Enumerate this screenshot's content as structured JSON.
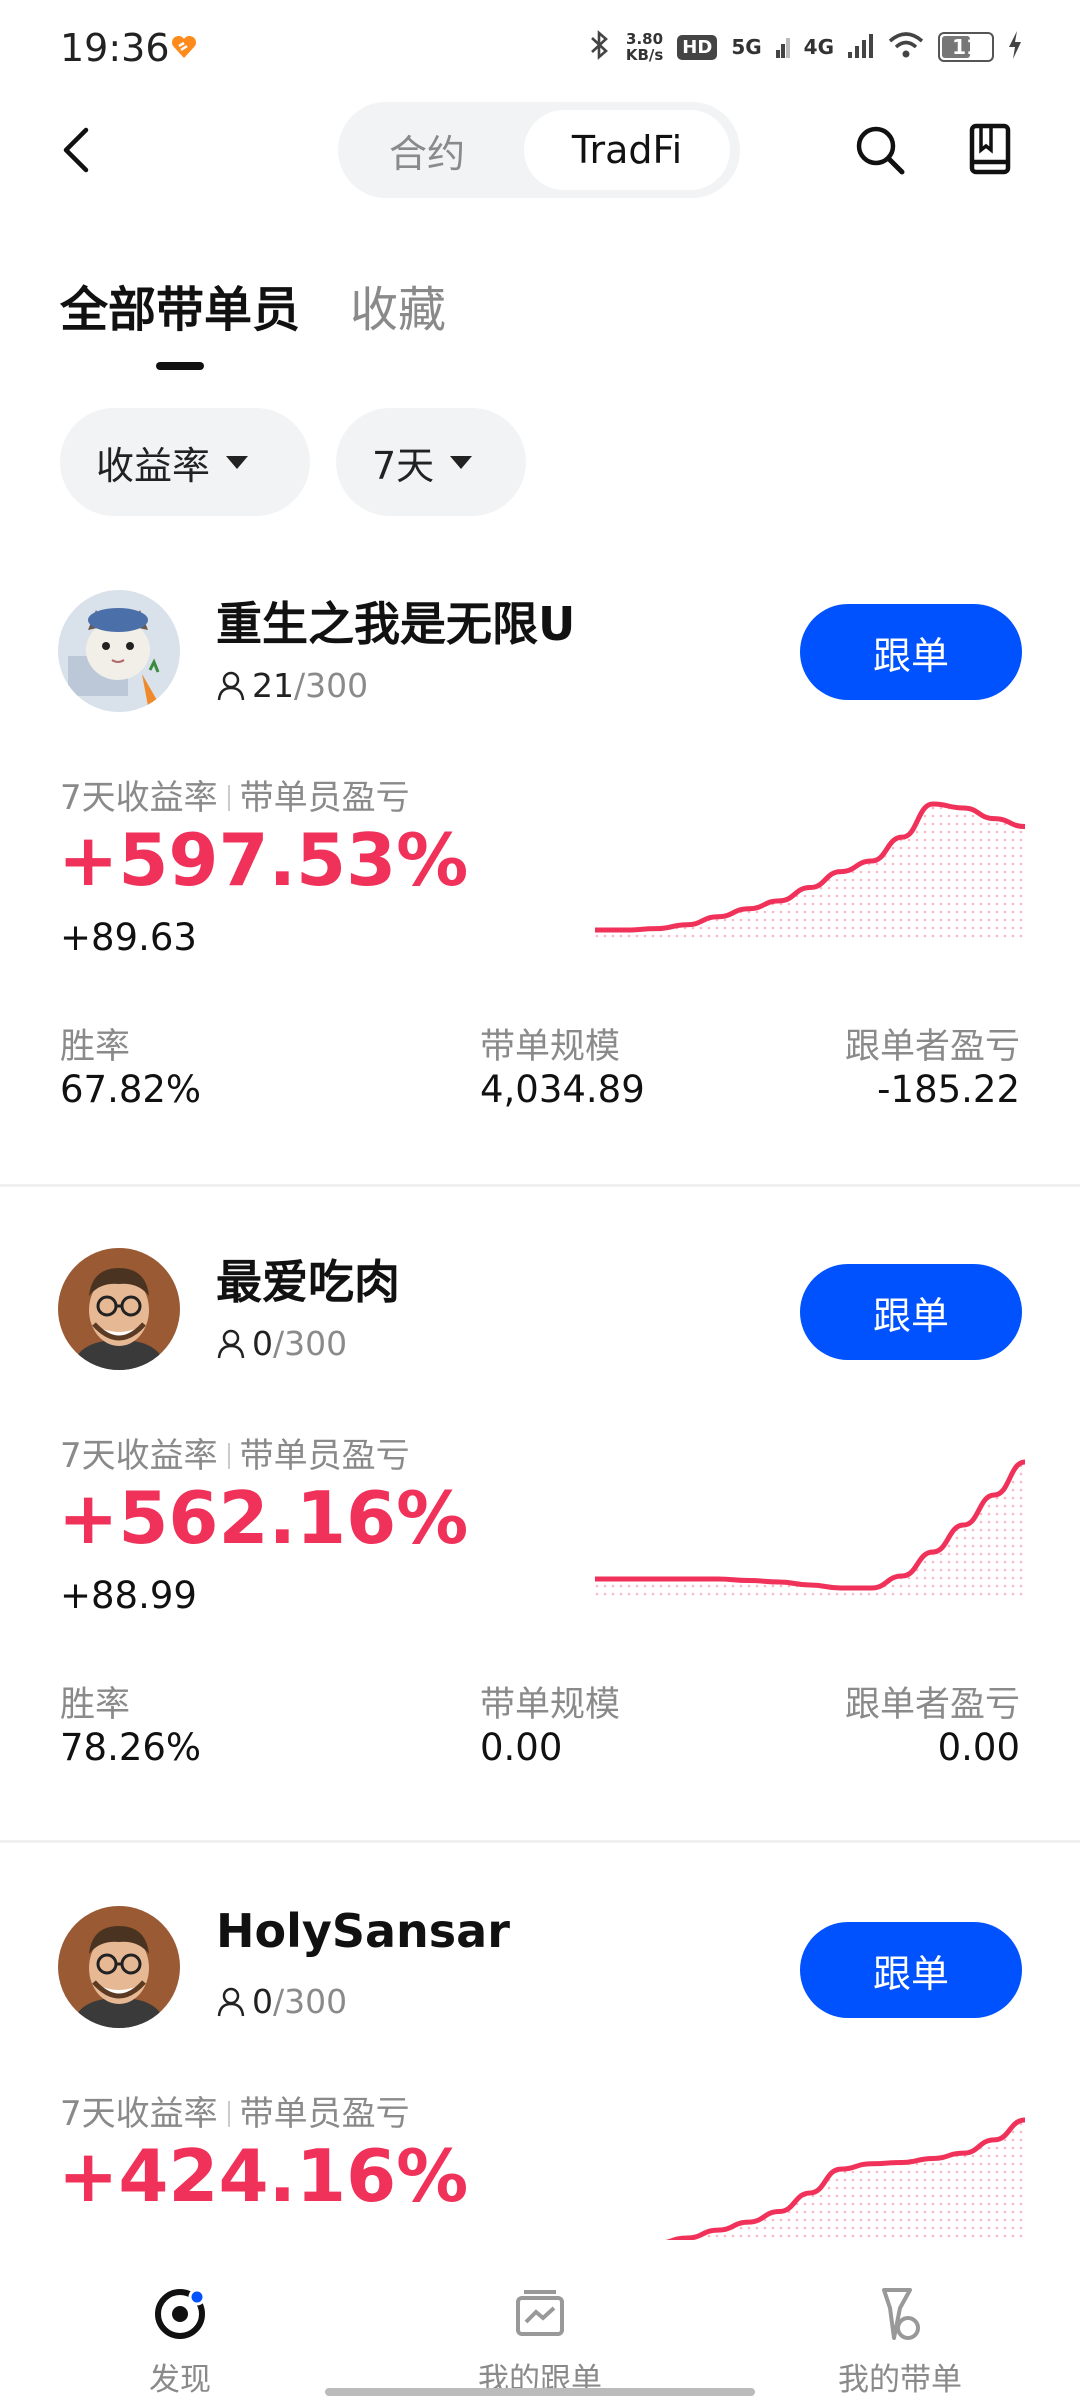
{
  "status_bar": {
    "time": "19:36",
    "net_speed_value": "3.80",
    "net_speed_unit": "KB/s",
    "hd": "HD",
    "sim1": "5G",
    "sim2": "4G",
    "battery": "11",
    "icons": [
      "heart-badge-icon",
      "bluetooth-icon",
      "hd-icon",
      "signal-icon",
      "wifi-icon",
      "battery-icon",
      "charging-icon"
    ]
  },
  "nav": {
    "tabs": [
      "合约",
      "TradFi"
    ],
    "active_tab": "TradFi"
  },
  "main_tabs": [
    "全部带单员",
    "收藏"
  ],
  "filters": [
    "收益率",
    "7天"
  ],
  "labels": {
    "roi_label": "7天收益率",
    "pnl_label": "带单员盈亏",
    "win_rate": "胜率",
    "scale": "带单规模",
    "follower_pnl": "跟单者盈亏",
    "follow_button": "跟单"
  },
  "traders": [
    {
      "name": "重生之我是无限U",
      "followers": "21",
      "max_followers": "/300",
      "roi": "+597.53%",
      "pnl": "+89.63",
      "win_rate": "67.82%",
      "scale": "4,034.89",
      "follower_pnl": "-185.22",
      "trend": [
        0,
        0,
        1,
        4,
        10,
        16,
        22,
        32,
        44,
        52,
        70,
        95,
        92,
        84,
        78
      ]
    },
    {
      "name": "最爱吃肉",
      "followers": "0",
      "max_followers": "/300",
      "roi": "+562.16%",
      "pnl": "+88.99",
      "win_rate": "78.26%",
      "scale": "0.00",
      "follower_pnl": "0.00",
      "trend": [
        20,
        20,
        20,
        20,
        20,
        19,
        18,
        16,
        14,
        14,
        22,
        38,
        56,
        76,
        98
      ]
    },
    {
      "name": "HolySansar",
      "followers": "0",
      "max_followers": "/300",
      "roi": "+424.16%",
      "trend": [
        0,
        0,
        2,
        6,
        12,
        18,
        26,
        40,
        58,
        62,
        63,
        66,
        70,
        80,
        95
      ]
    }
  ],
  "bottom_nav": [
    {
      "label": "发现",
      "icon": "discover-icon",
      "active": true
    },
    {
      "label": "我的跟单",
      "icon": "copy-trading-icon",
      "active": false
    },
    {
      "label": "我的带单",
      "icon": "lead-trading-icon",
      "active": false
    }
  ],
  "colors": {
    "accent_blue": "#0052ff",
    "profit_red": "#f0325a",
    "muted_text": "#8a8a8a"
  }
}
